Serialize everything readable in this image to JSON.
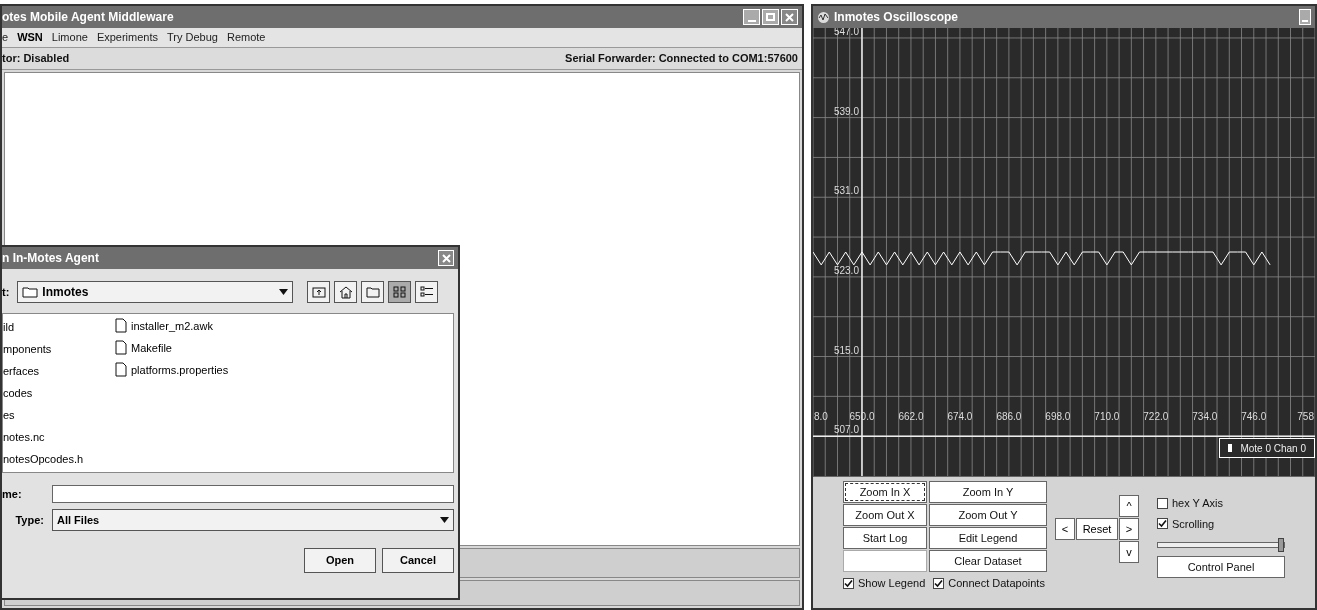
{
  "main_window": {
    "title": "otes Mobile Agent Middleware",
    "menu": [
      {
        "label": "e",
        "selected": false
      },
      {
        "label": "WSN",
        "selected": true
      },
      {
        "label": "Limone",
        "selected": false
      },
      {
        "label": "Experiments",
        "selected": false
      },
      {
        "label": "Try Debug",
        "selected": false
      },
      {
        "label": "Remote",
        "selected": false
      }
    ],
    "status_left": "tor: Disabled",
    "status_right": "Serial Forwarder: Connected to COM1:57600"
  },
  "open_dialog": {
    "title": "n In-Motes Agent",
    "look_in_label": "t:",
    "look_in_value": "Inmotes",
    "toolbar": [
      {
        "kind": "up",
        "selected": false
      },
      {
        "kind": "home",
        "selected": false
      },
      {
        "kind": "new-folder",
        "selected": false
      },
      {
        "kind": "list",
        "selected": true
      },
      {
        "kind": "details",
        "selected": false
      }
    ],
    "files_column_1": [
      "ild",
      "mponents",
      "erfaces",
      "codes",
      "es",
      "notes.nc",
      "notesOpcodes.h"
    ],
    "files_column_2": [
      "installer_m2.awk",
      "Makefile",
      "platforms.properties"
    ],
    "file_name_label": "me:",
    "type_label": "Type:",
    "type_value": "All Files",
    "buttons": [
      "Open",
      "Cancel"
    ]
  },
  "oscilloscope": {
    "title": "Inmotes Oscilloscope",
    "axis_edge_labels": [
      "8.0",
      "758"
    ],
    "chart_data": {
      "type": "line",
      "grid": true,
      "xlim": [
        638,
        761
      ],
      "ylim": [
        503,
        548
      ],
      "xticks": [
        {
          "value": 650,
          "label": "650.0"
        },
        {
          "value": 662,
          "label": "662.0"
        },
        {
          "value": 674,
          "label": "674.0"
        },
        {
          "value": 686,
          "label": "686.0"
        },
        {
          "value": 698,
          "label": "698.0"
        },
        {
          "value": 710,
          "label": "710.0"
        },
        {
          "value": 722,
          "label": "722.0"
        },
        {
          "value": 734,
          "label": "734.0"
        },
        {
          "value": 746,
          "label": "746.0"
        }
      ],
      "yticks": [
        {
          "value": 507,
          "label": "507.0"
        },
        {
          "value": 515,
          "label": "515.0"
        },
        {
          "value": 523,
          "label": "523.0"
        },
        {
          "value": 531,
          "label": "531.0"
        },
        {
          "value": 539,
          "label": "539.0"
        },
        {
          "value": 547,
          "label": "547.0"
        }
      ],
      "x": [
        638,
        640,
        642,
        644,
        646,
        648,
        650,
        652,
        654,
        656,
        658,
        660,
        662,
        664,
        666,
        668,
        670,
        672,
        674,
        676,
        678,
        680,
        682,
        684,
        686,
        688,
        690,
        692,
        694,
        696,
        698,
        700,
        702,
        704,
        706,
        708,
        710,
        712,
        714,
        716,
        718,
        720,
        722,
        724,
        726,
        728,
        730,
        732,
        734,
        736,
        738,
        740,
        742,
        744,
        746,
        748,
        750
      ],
      "series": [
        {
          "name": "Mote 0 Chan 0",
          "color": "#ffffff",
          "values": [
            525.5,
            524.2,
            525.5,
            524.2,
            525.5,
            524.2,
            525.5,
            524.2,
            525.5,
            524.2,
            525.5,
            524.2,
            525.5,
            524.2,
            525.5,
            524.2,
            525.5,
            524.2,
            525.5,
            524.2,
            525.5,
            524.2,
            525.5,
            525.5,
            525.5,
            524.2,
            525.5,
            525.5,
            525.5,
            525.5,
            524.2,
            525.5,
            524.2,
            525.5,
            525.5,
            525.5,
            524.2,
            525.5,
            525.5,
            524.2,
            525.5,
            525.5,
            525.5,
            525.5,
            525.5,
            525.5,
            525.5,
            525.5,
            525.5,
            525.5,
            524.2,
            525.5,
            525.5,
            525.5,
            524.2,
            525.5,
            524.2
          ]
        }
      ]
    },
    "buttons": [
      {
        "label": "Zoom In X",
        "focused": true,
        "disabled": false
      },
      {
        "label": "Zoom In Y",
        "focused": false,
        "disabled": false
      },
      {
        "label": "Zoom Out X",
        "focused": false,
        "disabled": false
      },
      {
        "label": "Zoom Out Y",
        "focused": false,
        "disabled": false
      },
      {
        "label": "Start Log",
        "focused": false,
        "disabled": false
      },
      {
        "label": "Edit Legend",
        "focused": false,
        "disabled": false
      },
      {
        "focused": false,
        "disabled": true
      },
      {
        "label": "Clear Dataset",
        "focused": false,
        "disabled": false
      }
    ],
    "nav": {
      "up": "^",
      "left": "<",
      "reset": "Reset",
      "right": ">",
      "down": "v"
    },
    "side_checkboxes": [
      {
        "label": "hex Y Axis",
        "checked": false
      },
      {
        "label": "Scrolling",
        "checked": true
      }
    ],
    "slider": {
      "level": 1
    },
    "control_panel_button": "Control Panel",
    "bottom_checkboxes": [
      {
        "label": "Show Legend",
        "checked": true
      },
      {
        "label": "Connect Datapoints",
        "checked": true
      }
    ]
  }
}
